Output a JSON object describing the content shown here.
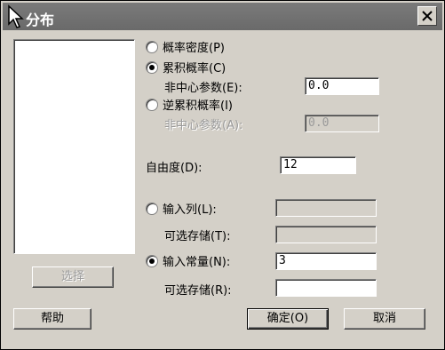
{
  "window": {
    "title": "分布"
  },
  "buttons": {
    "select": "选择",
    "help": "帮助",
    "ok": "确定(O)",
    "cancel": "取消"
  },
  "options": {
    "pdf": "概率密度(P)",
    "cdf": "累积概率(C)",
    "noncentral1": "非中心参数(E):",
    "noncentral1_value": "0.0",
    "icdf": "逆累积概率(I)",
    "noncentral2": "非中心参数(A):",
    "noncentral2_value": "0.0"
  },
  "dof": {
    "label": "自由度(D):",
    "value": "12"
  },
  "input": {
    "column_label": "输入列(L):",
    "column_value": "",
    "optional_store1": "可选存储(T):",
    "optional_store1_value": "",
    "constant_label": "输入常量(N):",
    "constant_value": "3",
    "optional_store2": "可选存储(R):",
    "optional_store2_value": ""
  },
  "state": {
    "selected_mode": "cdf",
    "selected_input": "constant"
  }
}
